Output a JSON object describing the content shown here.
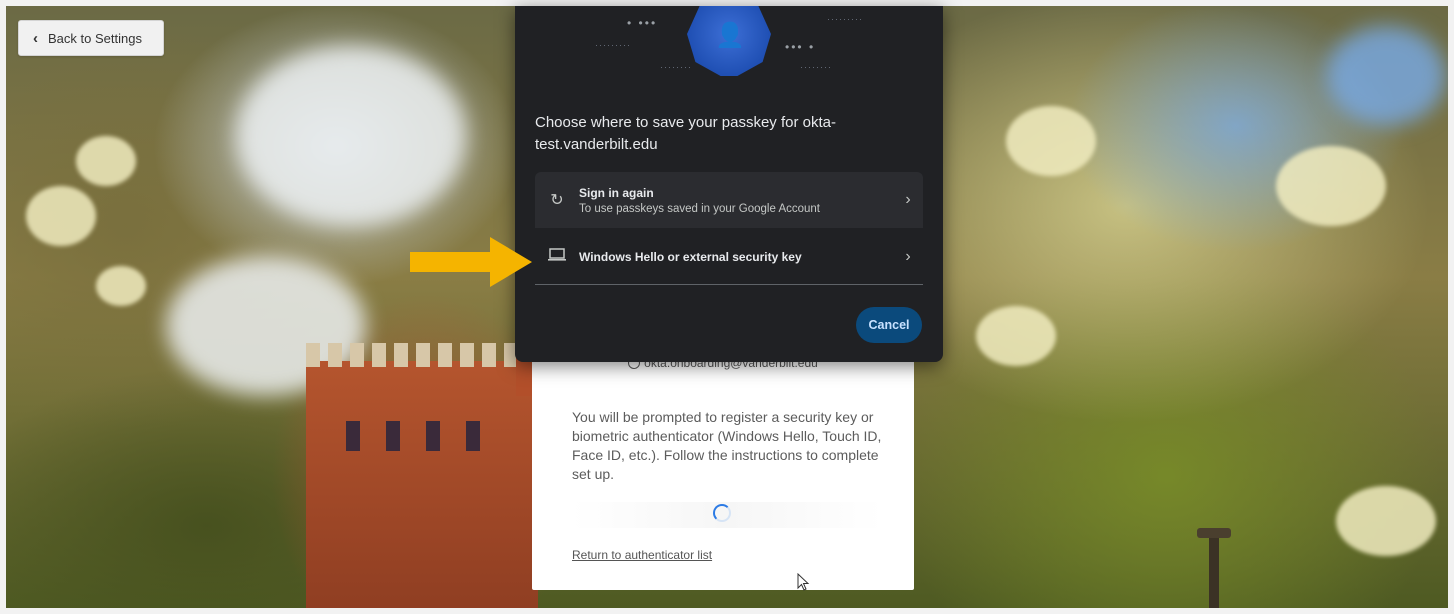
{
  "back_button": {
    "label": "Back to Settings",
    "icon": "chevron-left-icon"
  },
  "dialog": {
    "title": "Choose where to save your passkey for okta-test.vanderbilt.edu",
    "hero_icon": "passkey-person-key-icon",
    "options": [
      {
        "title": "Sign in again",
        "subtitle": "To use passkeys saved in your Google Account",
        "icon": "sync-icon"
      },
      {
        "title": "Windows Hello or external security key",
        "subtitle": "",
        "icon": "laptop-icon"
      }
    ],
    "cancel_label": "Cancel",
    "accent_color": "#0b4a7c"
  },
  "okta_card": {
    "user_email": "okta.onboarding@vanderbilt.edu",
    "instructions": "You will be prompted to register a security key or biometric authenticator (Windows Hello, Touch ID, Face ID, etc.). Follow the instructions to complete set up.",
    "return_link": "Return to authenticator list"
  },
  "annotation": {
    "arrow_color": "#f5b400"
  }
}
